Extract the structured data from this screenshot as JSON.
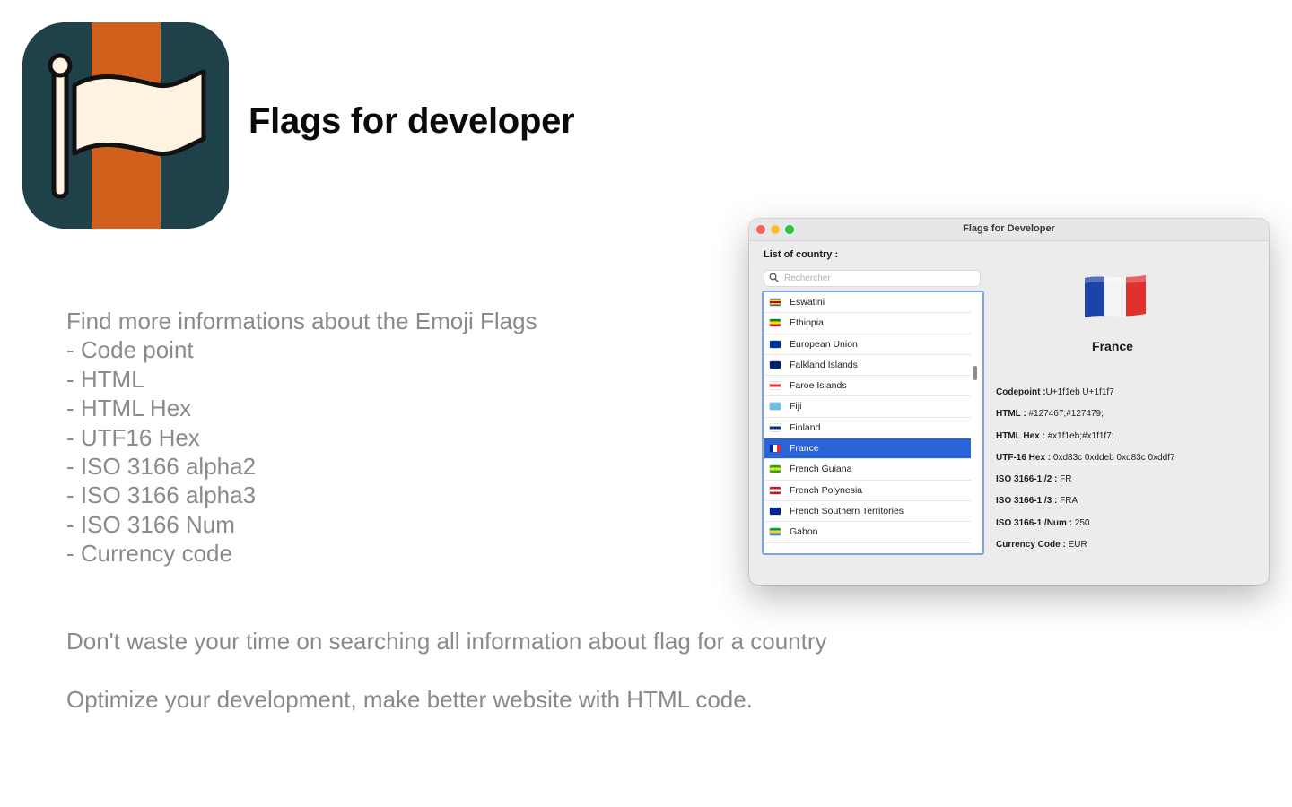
{
  "hero": {
    "title": "Flags for developer",
    "icon": "flag-icon",
    "icon_colors": {
      "dark": "#1f4149",
      "orange": "#d2601d",
      "flag": "#fdf3e0",
      "outline": "#111111"
    }
  },
  "features": [
    "Find more informations about the Emoji Flags",
    "- Code point",
    "- HTML",
    "- HTML Hex",
    "- UTF16 Hex",
    "- ISO 3166 alpha2",
    "- ISO 3166 alpha3",
    "- ISO 3166 Num",
    "- Currency code"
  ],
  "taglines": [
    "Don't waste your time on searching all information about flag for a country",
    "Optimize your development, make better website with HTML code."
  ],
  "window": {
    "title": "Flags for Developer",
    "list_label": "List of country :",
    "search_placeholder": "Rechercher",
    "countries": [
      {
        "name": "Eswatini",
        "flag_colors": [
          "#3e5eb9",
          "#ffd900",
          "#b10c0c",
          "#ffd900",
          "#3e5eb9"
        ]
      },
      {
        "name": "Ethiopia",
        "flag_colors": [
          "#078930",
          "#fcdd09",
          "#da121a"
        ]
      },
      {
        "name": "European Union",
        "flag_colors": [
          "#003399",
          "#003399",
          "#003399"
        ]
      },
      {
        "name": "Falkland Islands",
        "flag_colors": [
          "#012169",
          "#012169",
          "#012169"
        ]
      },
      {
        "name": "Faroe Islands",
        "flag_colors": [
          "#ffffff",
          "#ed2939",
          "#ffffff"
        ]
      },
      {
        "name": "Fiji",
        "flag_colors": [
          "#68bfe5",
          "#68bfe5",
          "#68bfe5"
        ]
      },
      {
        "name": "Finland",
        "flag_colors": [
          "#ffffff",
          "#003580",
          "#ffffff"
        ]
      },
      {
        "name": "France",
        "flag_colors": [
          "#002395",
          "#ffffff",
          "#ed2939"
        ],
        "selected": true
      },
      {
        "name": "French Guiana",
        "flag_colors": [
          "#12ad2b",
          "#fcdd09",
          "#12ad2b"
        ]
      },
      {
        "name": "French Polynesia",
        "flag_colors": [
          "#ce1126",
          "#ffffff",
          "#ce1126"
        ]
      },
      {
        "name": "French Southern Territories",
        "flag_colors": [
          "#002395",
          "#002395",
          "#002395"
        ]
      },
      {
        "name": "Gabon",
        "flag_colors": [
          "#009e60",
          "#fcd116",
          "#3a75c4"
        ]
      }
    ],
    "selected_country": "France",
    "details": [
      {
        "label": "Codepoint :",
        "value": "U+1f1eb U+1f1f7"
      },
      {
        "label": "HTML :",
        "value": " #127467;#127479;"
      },
      {
        "label": "HTML Hex :",
        "value": " #x1f1eb;#x1f1f7;"
      },
      {
        "label": "UTF-16 Hex :",
        "value": "  0xd83c 0xddeb 0xd83c 0xddf7"
      },
      {
        "label": "ISO 3166-1 /2 :",
        "value": " FR"
      },
      {
        "label": "ISO 3166-1 /3 :",
        "value": " FRA"
      },
      {
        "label": "ISO 3166-1 /Num :",
        "value": " 250"
      },
      {
        "label": "Currency Code :",
        "value": "  EUR"
      }
    ],
    "selection_color": "#2b64d8"
  }
}
